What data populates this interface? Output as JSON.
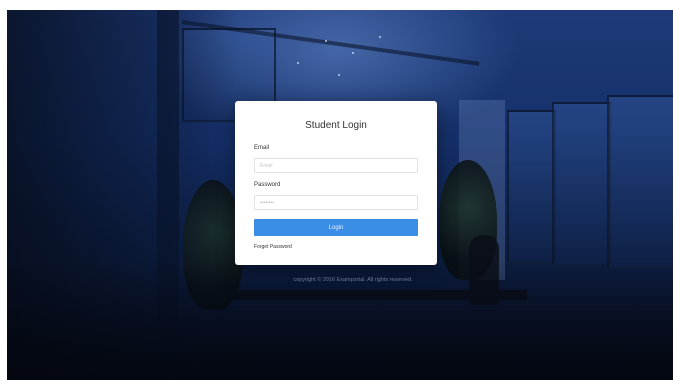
{
  "login": {
    "title": "Student Login",
    "email_label": "Email",
    "email_placeholder": "Email",
    "password_label": "Password",
    "password_value": "••••••••",
    "login_button": "Login",
    "forgot_password": "Forget Password"
  },
  "footer": {
    "copyright": "copyright © 2016 Examportal. All rights reserved."
  },
  "colors": {
    "button": "#3a8ee6",
    "background": "#15306a",
    "card": "#ffffff"
  }
}
